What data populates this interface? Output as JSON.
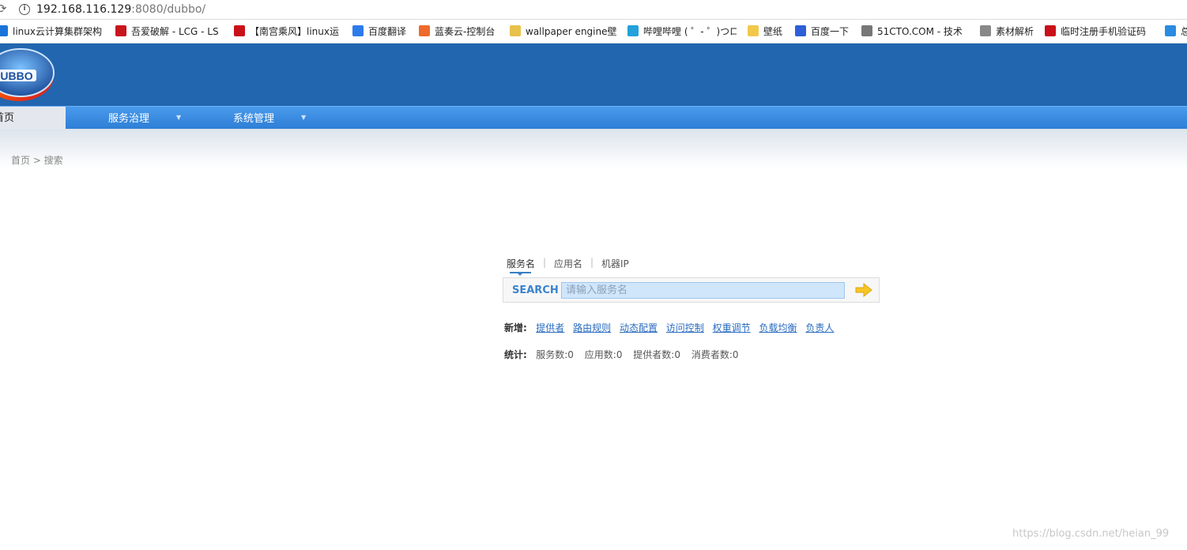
{
  "browser": {
    "url_host": "192.168.116.129",
    "url_rest": ":8080/dubbo/"
  },
  "bookmarks": [
    {
      "label": "linux云计算集群架构",
      "icon": "circle-blue-icon",
      "color": "#1a73d9"
    },
    {
      "label": "吾爱破解 - LCG - LS",
      "icon": "red-seal-icon",
      "color": "#c8161d"
    },
    {
      "label": "【南宫乘风】linux运",
      "icon": "csdn-c-icon",
      "color": "#c9111a"
    },
    {
      "label": "百度翻译",
      "icon": "translate-icon",
      "color": "#2d7bea"
    },
    {
      "label": "蓝奏云-控制台",
      "icon": "flag-icon",
      "color": "#ef6a2a"
    },
    {
      "label": "wallpaper engine壁",
      "icon": "bird-icon",
      "color": "#e7c14a"
    },
    {
      "label": "哔哩哔哩 ( ゜- ゜)つロ",
      "icon": "bilibili-icon",
      "color": "#23a1db"
    },
    {
      "label": "壁纸",
      "icon": "folder-icon",
      "color": "#f1c84a"
    },
    {
      "label": "百度一下",
      "icon": "paw-icon",
      "color": "#2d5fd8"
    },
    {
      "label": "51CTO.COM - 技术",
      "icon": "chain-icon",
      "color": "#777777"
    },
    {
      "label": "素材解析",
      "icon": "page-icon",
      "color": "#888888"
    },
    {
      "label": "临时注册手机验证码",
      "icon": "csdn-c-icon",
      "color": "#c9111a"
    },
    {
      "label": "总",
      "icon": "cloud-icon",
      "color": "#2a8be0"
    }
  ],
  "nav": {
    "home": "首页",
    "items": [
      "服务治理",
      "系统管理"
    ],
    "caret": "▼"
  },
  "breadcrumb": "首页 > 搜索",
  "search": {
    "tabs": [
      "服务名",
      "应用名",
      "机器IP"
    ],
    "separator": "|",
    "label": "SEARCH",
    "placeholder": "请输入服务名"
  },
  "add": {
    "label": "新增:",
    "links": [
      "提供者",
      "路由规则",
      "动态配置",
      "访问控制",
      "权重调节",
      "负载均衡",
      "负责人"
    ]
  },
  "stats": {
    "label": "统计:",
    "items": [
      "服务数:0",
      "应用数:0",
      "提供者数:0",
      "消费者数:0"
    ]
  },
  "watermark": "https://blog.csdn.net/heian_99",
  "colors": {
    "header": "#2266b0",
    "nav": "#3a8ae2",
    "link": "#2a6cbf",
    "search_label": "#3b84cf"
  }
}
